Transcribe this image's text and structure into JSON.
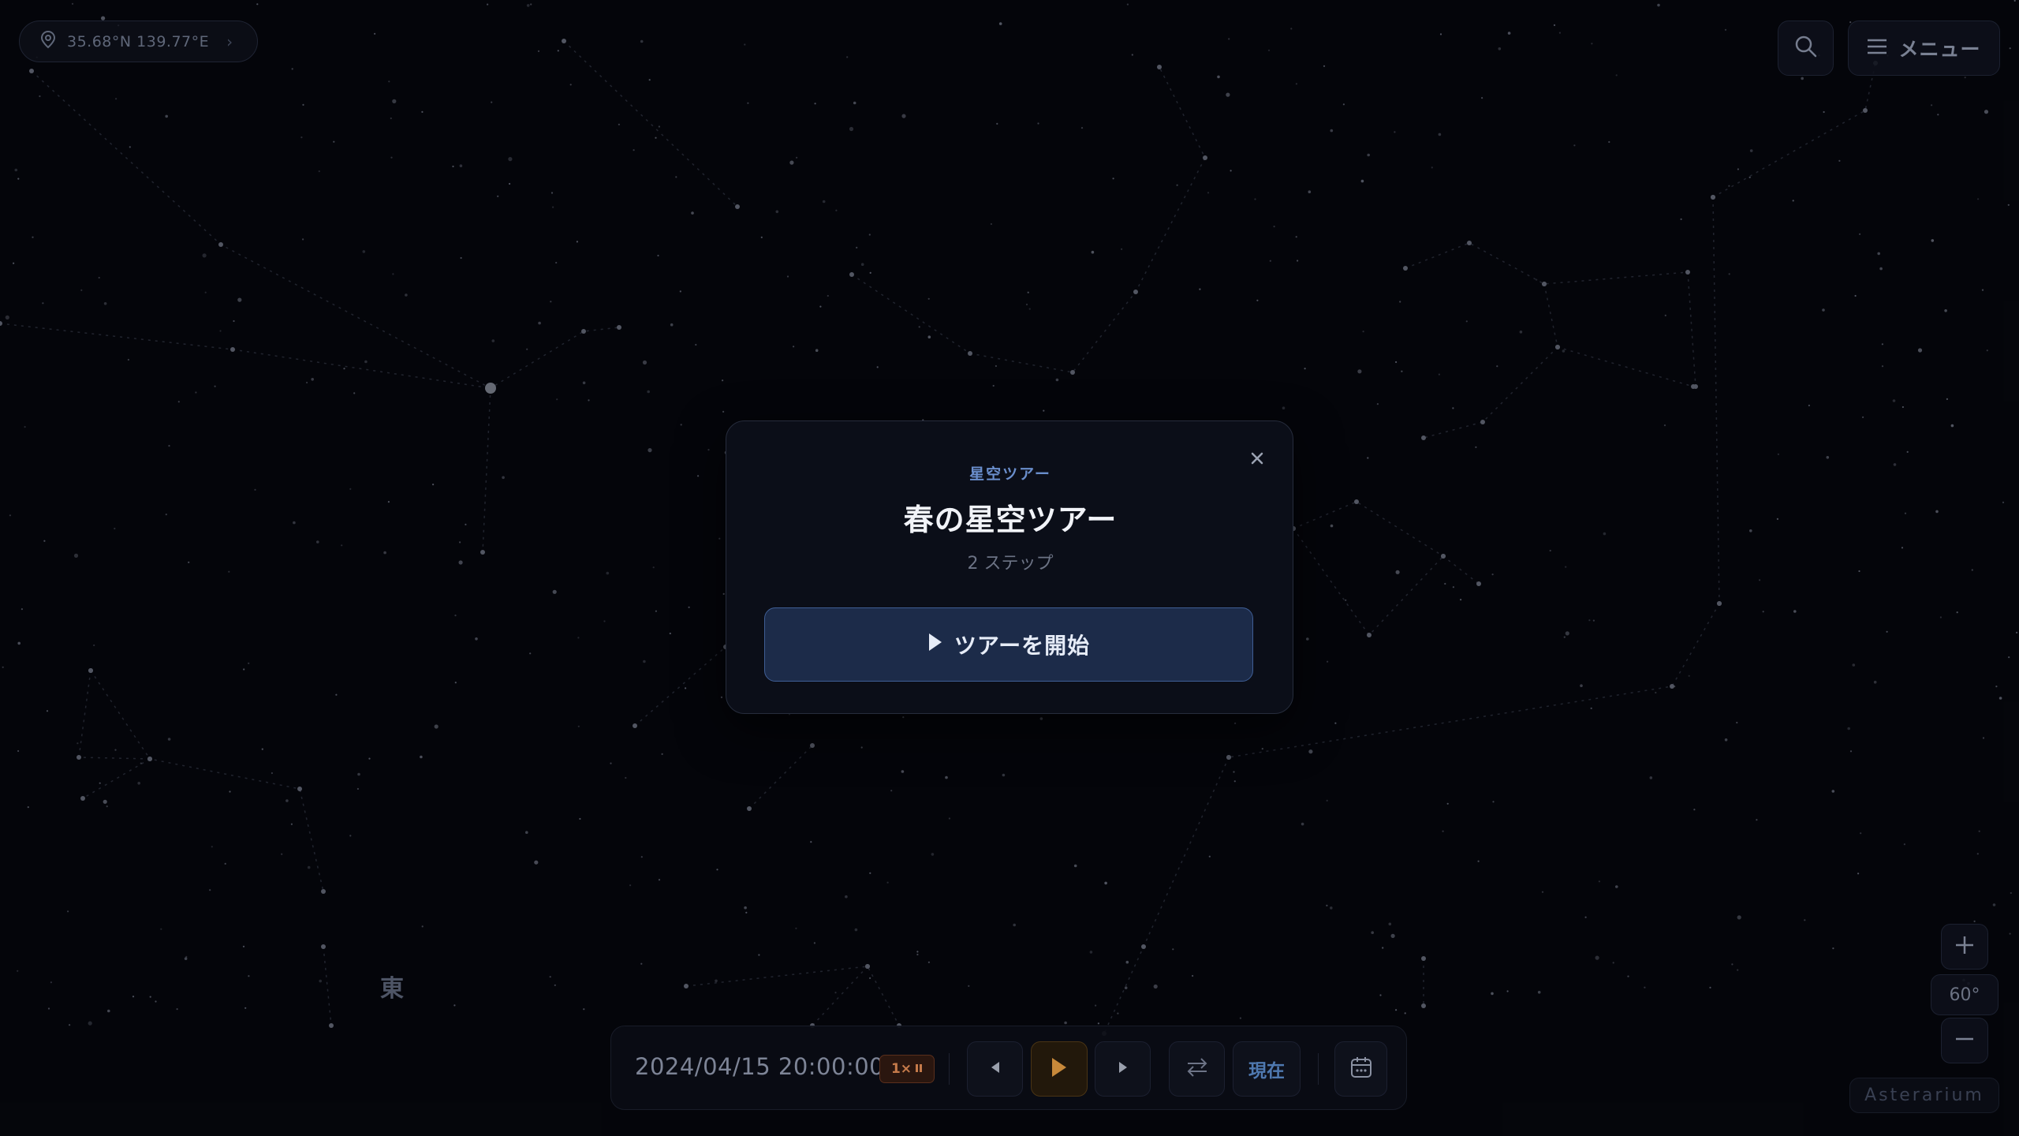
{
  "location": {
    "coords": "35.68°N 139.77°E",
    "chevron": "›"
  },
  "header": {
    "menu_label": "メニュー"
  },
  "sky": {
    "compass_east": "東"
  },
  "zoom": {
    "fov": "60°"
  },
  "brand": "Asterarium",
  "time_bar": {
    "datetime": "2024/04/15 20:00:00",
    "speed": "1×",
    "now_label": "現在"
  },
  "tour_modal": {
    "eyebrow": "星空ツアー",
    "title": "春の星空ツアー",
    "steps": "2 ステップ",
    "start_label": "ツアーを開始"
  },
  "colors": {
    "background": "#06070c",
    "accent_blue": "#6a8ecc",
    "play_accent": "#c8893a",
    "speed_badge": "#c57a4a"
  }
}
